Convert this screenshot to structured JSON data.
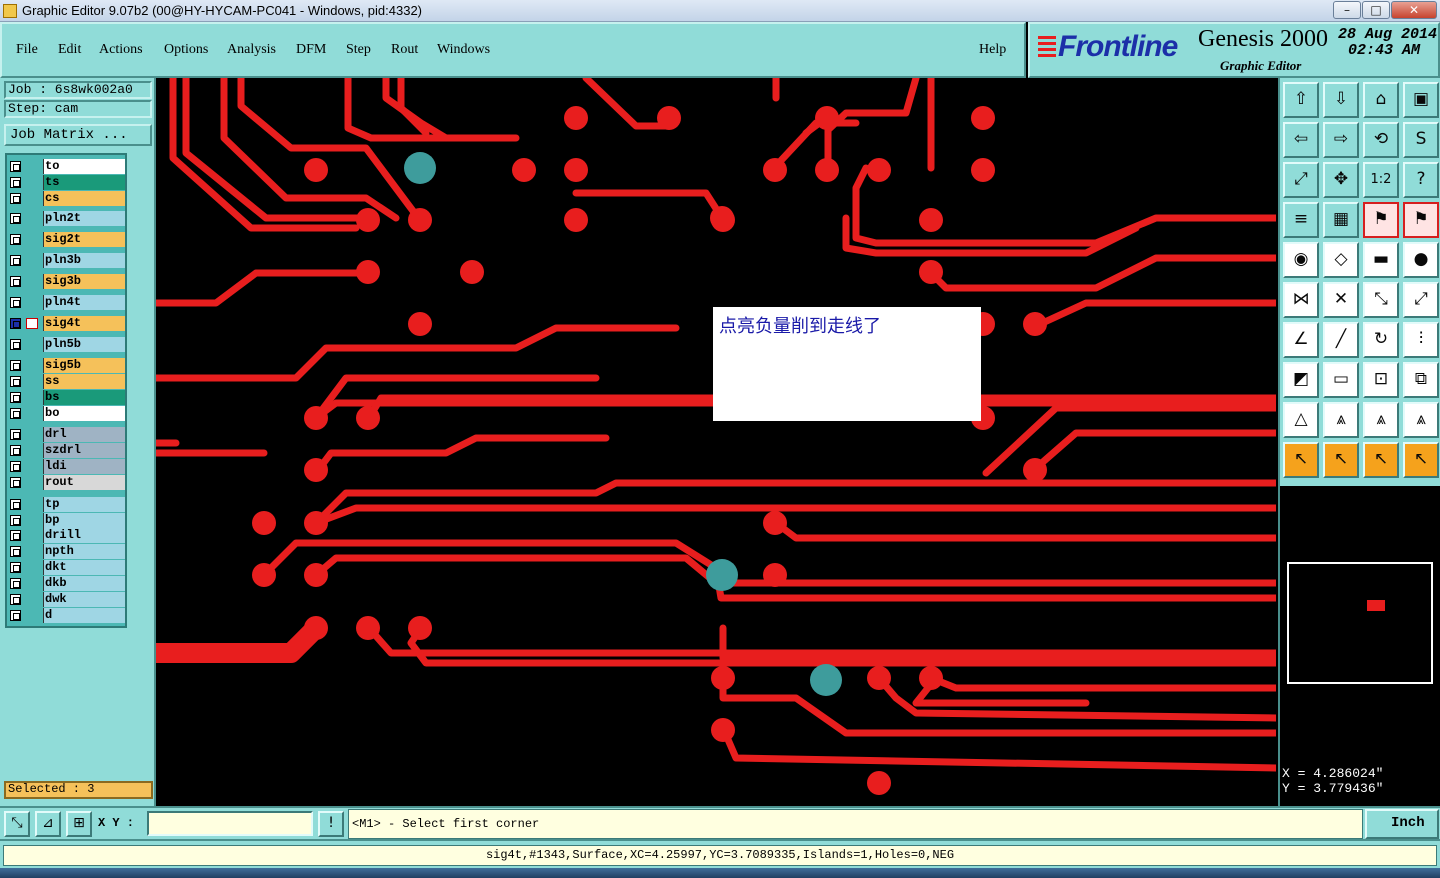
{
  "window": {
    "title": "Graphic Editor 9.07b2 (00@HY-HYCAM-PC041 - Windows, pid:4332)"
  },
  "menu": [
    "File",
    "Edit",
    "Actions",
    "Options",
    "Analysis",
    "DFM",
    "Step",
    "Rout",
    "Windows"
  ],
  "help_label": "Help",
  "brand": {
    "logo": "Frontline",
    "product": "Genesis 2000",
    "subtitle": "Graphic Editor",
    "date": "28 Aug 2014",
    "time": "02:43 AM"
  },
  "job": {
    "job_label": "Job  :  6s8wk002a0",
    "step_label": "Step:  cam",
    "matrix_button": "Job Matrix ..."
  },
  "layers": [
    {
      "name": "to",
      "color": "#ffffff"
    },
    {
      "name": "ts",
      "color": "#1a9a7a"
    },
    {
      "name": "cs",
      "color": "#f5c15a"
    },
    {
      "name": "pln2t",
      "color": "#9fd6e4"
    },
    {
      "name": "sig2t",
      "color": "#f5c15a"
    },
    {
      "name": "pln3b",
      "color": "#9fd6e4"
    },
    {
      "name": "sig3b",
      "color": "#f5c15a"
    },
    {
      "name": "pln4t",
      "color": "#9fd6e4"
    },
    {
      "name": "sig4t",
      "color": "#f5c15a"
    },
    {
      "name": "pln5b",
      "color": "#9fd6e4"
    },
    {
      "name": "sig5b",
      "color": "#f5c15a"
    },
    {
      "name": "ss",
      "color": "#f5c15a"
    },
    {
      "name": "bs",
      "color": "#1a9a7a"
    },
    {
      "name": "bo",
      "color": "#ffffff"
    },
    {
      "name": "drl",
      "color": "#9fb3c4"
    },
    {
      "name": "szdrl",
      "color": "#9fb3c4"
    },
    {
      "name": "ldi",
      "color": "#9fb3c4"
    },
    {
      "name": "rout",
      "color": "#d8d8d8"
    },
    {
      "name": "tp",
      "color": "#9fd6e4"
    },
    {
      "name": "bp",
      "color": "#9fd6e4"
    },
    {
      "name": "drill",
      "color": "#9fd6e4"
    },
    {
      "name": "npth",
      "color": "#9fd6e4"
    },
    {
      "name": "dkt",
      "color": "#9fd6e4"
    },
    {
      "name": "dkb",
      "color": "#9fd6e4"
    },
    {
      "name": "dwk",
      "color": "#9fd6e4"
    },
    {
      "name": "d",
      "color": "#9fd6e4"
    }
  ],
  "selected_label": "Selected : 3",
  "note_text": "点亮负量削到走线了",
  "coords": {
    "x": "X  =  4.286024\"",
    "y": "Y  =  3.779436\""
  },
  "command": {
    "xy_label": "X Y :",
    "xy_value": "",
    "prompt": "<M1> - Select first corner",
    "units": "Inch"
  },
  "status": "sig4t,#1343,Surface,XC=4.25997,YC=3.7089335,Islands=1,Holes=0,NEG",
  "colors": {
    "trace": "#e81e1e",
    "panel": "#90dcd8",
    "highlight_pad": "#3e9c9c"
  }
}
